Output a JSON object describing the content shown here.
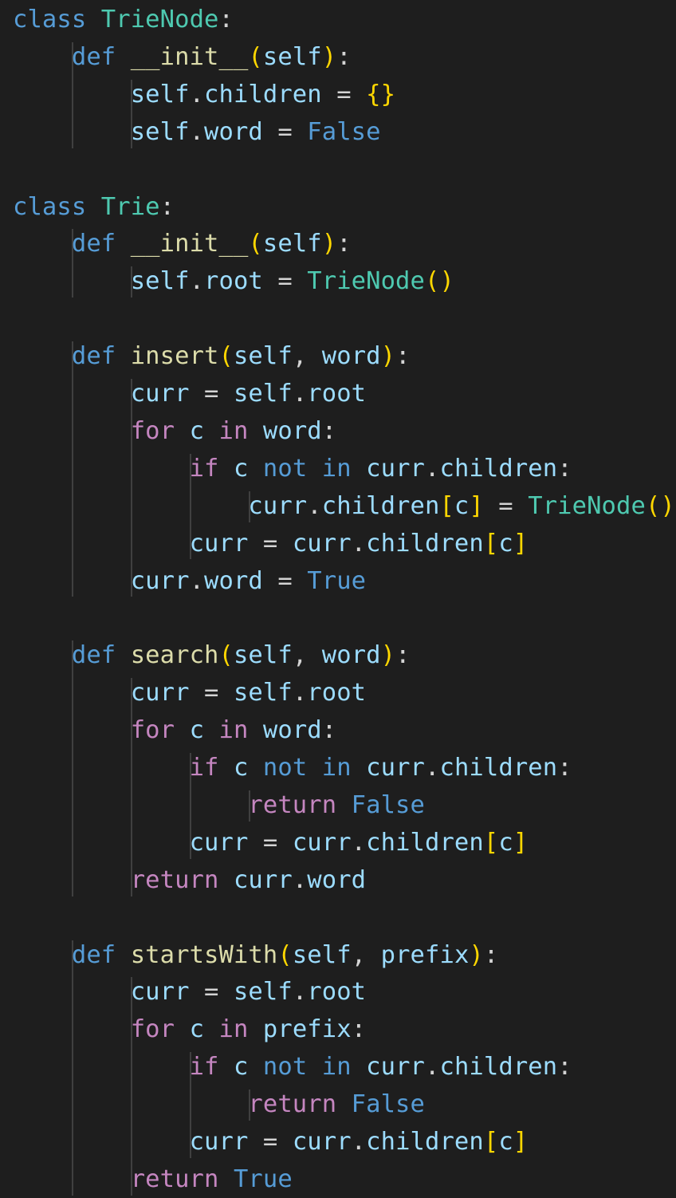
{
  "editor": {
    "language": "python",
    "colors": {
      "background": "#1e1e1e",
      "keyword": "#569cd6",
      "control": "#c586c0",
      "class_name": "#4ec9b0",
      "function": "#dcdcaa",
      "variable": "#9cdcfe",
      "default_text": "#d4d4d4",
      "bracket_1": "#ffd700",
      "bracket_2": "#da70d6",
      "bracket_3": "#179fff",
      "indent_guide": "#404040"
    },
    "lines": [
      [
        {
          "t": "class",
          "c": "keyword"
        },
        {
          "t": " "
        },
        {
          "t": "TrieNode",
          "c": "class_name"
        },
        {
          "t": ":"
        }
      ],
      [
        {
          "t": "    "
        },
        {
          "t": "def",
          "c": "keyword"
        },
        {
          "t": " "
        },
        {
          "t": "__init__",
          "c": "function"
        },
        {
          "t": "(",
          "c": "bracket_1"
        },
        {
          "t": "self",
          "c": "variable"
        },
        {
          "t": ")",
          "c": "bracket_1"
        },
        {
          "t": ":"
        }
      ],
      [
        {
          "t": "        "
        },
        {
          "t": "self",
          "c": "variable"
        },
        {
          "t": "."
        },
        {
          "t": "children",
          "c": "variable"
        },
        {
          "t": " = "
        },
        {
          "t": "{}",
          "c": "bracket_1"
        }
      ],
      [
        {
          "t": "        "
        },
        {
          "t": "self",
          "c": "variable"
        },
        {
          "t": "."
        },
        {
          "t": "word",
          "c": "variable"
        },
        {
          "t": " = "
        },
        {
          "t": "False",
          "c": "keyword"
        }
      ],
      [],
      [
        {
          "t": "class",
          "c": "keyword"
        },
        {
          "t": " "
        },
        {
          "t": "Trie",
          "c": "class_name"
        },
        {
          "t": ":"
        }
      ],
      [
        {
          "t": "    "
        },
        {
          "t": "def",
          "c": "keyword"
        },
        {
          "t": " "
        },
        {
          "t": "__init__",
          "c": "function"
        },
        {
          "t": "(",
          "c": "bracket_1"
        },
        {
          "t": "self",
          "c": "variable"
        },
        {
          "t": ")",
          "c": "bracket_1"
        },
        {
          "t": ":"
        }
      ],
      [
        {
          "t": "        "
        },
        {
          "t": "self",
          "c": "variable"
        },
        {
          "t": "."
        },
        {
          "t": "root",
          "c": "variable"
        },
        {
          "t": " = "
        },
        {
          "t": "TrieNode",
          "c": "class_name"
        },
        {
          "t": "()",
          "c": "bracket_1"
        }
      ],
      [],
      [
        {
          "t": "    "
        },
        {
          "t": "def",
          "c": "keyword"
        },
        {
          "t": " "
        },
        {
          "t": "insert",
          "c": "function"
        },
        {
          "t": "(",
          "c": "bracket_1"
        },
        {
          "t": "self",
          "c": "variable"
        },
        {
          "t": ", "
        },
        {
          "t": "word",
          "c": "variable"
        },
        {
          "t": ")",
          "c": "bracket_1"
        },
        {
          "t": ":"
        }
      ],
      [
        {
          "t": "        "
        },
        {
          "t": "curr",
          "c": "variable"
        },
        {
          "t": " = "
        },
        {
          "t": "self",
          "c": "variable"
        },
        {
          "t": "."
        },
        {
          "t": "root",
          "c": "variable"
        }
      ],
      [
        {
          "t": "        "
        },
        {
          "t": "for",
          "c": "control"
        },
        {
          "t": " "
        },
        {
          "t": "c",
          "c": "variable"
        },
        {
          "t": " "
        },
        {
          "t": "in",
          "c": "control"
        },
        {
          "t": " "
        },
        {
          "t": "word",
          "c": "variable"
        },
        {
          "t": ":"
        }
      ],
      [
        {
          "t": "            "
        },
        {
          "t": "if",
          "c": "control"
        },
        {
          "t": " "
        },
        {
          "t": "c",
          "c": "variable"
        },
        {
          "t": " "
        },
        {
          "t": "not",
          "c": "keyword"
        },
        {
          "t": " "
        },
        {
          "t": "in",
          "c": "keyword"
        },
        {
          "t": " "
        },
        {
          "t": "curr",
          "c": "variable"
        },
        {
          "t": "."
        },
        {
          "t": "children",
          "c": "variable"
        },
        {
          "t": ":"
        }
      ],
      [
        {
          "t": "                "
        },
        {
          "t": "curr",
          "c": "variable"
        },
        {
          "t": "."
        },
        {
          "t": "children",
          "c": "variable"
        },
        {
          "t": "[",
          "c": "bracket_1"
        },
        {
          "t": "c",
          "c": "variable"
        },
        {
          "t": "]",
          "c": "bracket_1"
        },
        {
          "t": " = "
        },
        {
          "t": "TrieNode",
          "c": "class_name"
        },
        {
          "t": "()",
          "c": "bracket_1"
        }
      ],
      [
        {
          "t": "            "
        },
        {
          "t": "curr",
          "c": "variable"
        },
        {
          "t": " = "
        },
        {
          "t": "curr",
          "c": "variable"
        },
        {
          "t": "."
        },
        {
          "t": "children",
          "c": "variable"
        },
        {
          "t": "[",
          "c": "bracket_1"
        },
        {
          "t": "c",
          "c": "variable"
        },
        {
          "t": "]",
          "c": "bracket_1"
        }
      ],
      [
        {
          "t": "        "
        },
        {
          "t": "curr",
          "c": "variable"
        },
        {
          "t": "."
        },
        {
          "t": "word",
          "c": "variable"
        },
        {
          "t": " = "
        },
        {
          "t": "True",
          "c": "keyword"
        }
      ],
      [],
      [
        {
          "t": "    "
        },
        {
          "t": "def",
          "c": "keyword"
        },
        {
          "t": " "
        },
        {
          "t": "search",
          "c": "function"
        },
        {
          "t": "(",
          "c": "bracket_1"
        },
        {
          "t": "self",
          "c": "variable"
        },
        {
          "t": ", "
        },
        {
          "t": "word",
          "c": "variable"
        },
        {
          "t": ")",
          "c": "bracket_1"
        },
        {
          "t": ":"
        }
      ],
      [
        {
          "t": "        "
        },
        {
          "t": "curr",
          "c": "variable"
        },
        {
          "t": " = "
        },
        {
          "t": "self",
          "c": "variable"
        },
        {
          "t": "."
        },
        {
          "t": "root",
          "c": "variable"
        }
      ],
      [
        {
          "t": "        "
        },
        {
          "t": "for",
          "c": "control"
        },
        {
          "t": " "
        },
        {
          "t": "c",
          "c": "variable"
        },
        {
          "t": " "
        },
        {
          "t": "in",
          "c": "control"
        },
        {
          "t": " "
        },
        {
          "t": "word",
          "c": "variable"
        },
        {
          "t": ":"
        }
      ],
      [
        {
          "t": "            "
        },
        {
          "t": "if",
          "c": "control"
        },
        {
          "t": " "
        },
        {
          "t": "c",
          "c": "variable"
        },
        {
          "t": " "
        },
        {
          "t": "not",
          "c": "keyword"
        },
        {
          "t": " "
        },
        {
          "t": "in",
          "c": "keyword"
        },
        {
          "t": " "
        },
        {
          "t": "curr",
          "c": "variable"
        },
        {
          "t": "."
        },
        {
          "t": "children",
          "c": "variable"
        },
        {
          "t": ":"
        }
      ],
      [
        {
          "t": "                "
        },
        {
          "t": "return",
          "c": "control"
        },
        {
          "t": " "
        },
        {
          "t": "False",
          "c": "keyword"
        }
      ],
      [
        {
          "t": "            "
        },
        {
          "t": "curr",
          "c": "variable"
        },
        {
          "t": " = "
        },
        {
          "t": "curr",
          "c": "variable"
        },
        {
          "t": "."
        },
        {
          "t": "children",
          "c": "variable"
        },
        {
          "t": "[",
          "c": "bracket_1"
        },
        {
          "t": "c",
          "c": "variable"
        },
        {
          "t": "]",
          "c": "bracket_1"
        }
      ],
      [
        {
          "t": "        "
        },
        {
          "t": "return",
          "c": "control"
        },
        {
          "t": " "
        },
        {
          "t": "curr",
          "c": "variable"
        },
        {
          "t": "."
        },
        {
          "t": "word",
          "c": "variable"
        }
      ],
      [],
      [
        {
          "t": "    "
        },
        {
          "t": "def",
          "c": "keyword"
        },
        {
          "t": " "
        },
        {
          "t": "startsWith",
          "c": "function"
        },
        {
          "t": "(",
          "c": "bracket_1"
        },
        {
          "t": "self",
          "c": "variable"
        },
        {
          "t": ", "
        },
        {
          "t": "prefix",
          "c": "variable"
        },
        {
          "t": ")",
          "c": "bracket_1"
        },
        {
          "t": ":"
        }
      ],
      [
        {
          "t": "        "
        },
        {
          "t": "curr",
          "c": "variable"
        },
        {
          "t": " = "
        },
        {
          "t": "self",
          "c": "variable"
        },
        {
          "t": "."
        },
        {
          "t": "root",
          "c": "variable"
        }
      ],
      [
        {
          "t": "        "
        },
        {
          "t": "for",
          "c": "control"
        },
        {
          "t": " "
        },
        {
          "t": "c",
          "c": "variable"
        },
        {
          "t": " "
        },
        {
          "t": "in",
          "c": "control"
        },
        {
          "t": " "
        },
        {
          "t": "prefix",
          "c": "variable"
        },
        {
          "t": ":"
        }
      ],
      [
        {
          "t": "            "
        },
        {
          "t": "if",
          "c": "control"
        },
        {
          "t": " "
        },
        {
          "t": "c",
          "c": "variable"
        },
        {
          "t": " "
        },
        {
          "t": "not",
          "c": "keyword"
        },
        {
          "t": " "
        },
        {
          "t": "in",
          "c": "keyword"
        },
        {
          "t": " "
        },
        {
          "t": "curr",
          "c": "variable"
        },
        {
          "t": "."
        },
        {
          "t": "children",
          "c": "variable"
        },
        {
          "t": ":"
        }
      ],
      [
        {
          "t": "                "
        },
        {
          "t": "return",
          "c": "control"
        },
        {
          "t": " "
        },
        {
          "t": "False",
          "c": "keyword"
        }
      ],
      [
        {
          "t": "            "
        },
        {
          "t": "curr",
          "c": "variable"
        },
        {
          "t": " = "
        },
        {
          "t": "curr",
          "c": "variable"
        },
        {
          "t": "."
        },
        {
          "t": "children",
          "c": "variable"
        },
        {
          "t": "[",
          "c": "bracket_1"
        },
        {
          "t": "c",
          "c": "variable"
        },
        {
          "t": "]",
          "c": "bracket_1"
        }
      ],
      [
        {
          "t": "        "
        },
        {
          "t": "return",
          "c": "control"
        },
        {
          "t": " "
        },
        {
          "t": "True",
          "c": "keyword"
        }
      ]
    ]
  }
}
